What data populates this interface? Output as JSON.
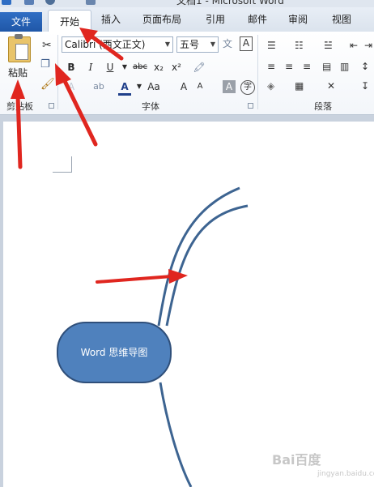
{
  "window": {
    "title": "文档1 - Microsoft Word"
  },
  "tabs": {
    "file": "文件",
    "home": "开始",
    "insert": "插入",
    "page_layout": "页面布局",
    "references": "引用",
    "mailings": "邮件",
    "review": "审阅",
    "view": "视图"
  },
  "clipboard": {
    "paste_label": "粘贴",
    "group_label": "剪贴板"
  },
  "font": {
    "font_name": "Calibri (西文正文)",
    "font_size": "五号",
    "bold": "B",
    "italic": "I",
    "underline": "U",
    "strikethrough": "abc",
    "subscript": "x₂",
    "superscript": "x²",
    "font_color": "A",
    "change_case": "Aa",
    "grow_font": "A",
    "shrink_font": "A",
    "char_shading": "A",
    "enclose_char": "字",
    "wen": "文",
    "group_label": "字体"
  },
  "paragraph": {
    "group_label": "段落"
  },
  "document": {
    "node_label": "Word 思维导图",
    "accent_color": "#4f81bd",
    "curve_color": "#3d6491",
    "annotation_color": "#e0261f"
  },
  "watermark": {
    "brand": "Bai百度",
    "sub": "jingyan.baidu.com"
  },
  "icons": [
    "word-icon",
    "save-icon",
    "undo-icon",
    "paste-icon",
    "cut-icon",
    "copy-icon",
    "format-painter-icon",
    "clear-format-icon",
    "text-effects-icon",
    "highlight-icon",
    "bullets-icon",
    "numbering-icon",
    "multilevel-list-icon",
    "decrease-indent-icon",
    "increase-indent-icon",
    "sort-icon",
    "show-marks-icon",
    "align-left-icon",
    "align-center-icon",
    "align-right-icon",
    "justify-icon",
    "distributed-icon",
    "line-spacing-icon",
    "shading-icon",
    "borders-icon",
    "chinese-layout-icon"
  ]
}
